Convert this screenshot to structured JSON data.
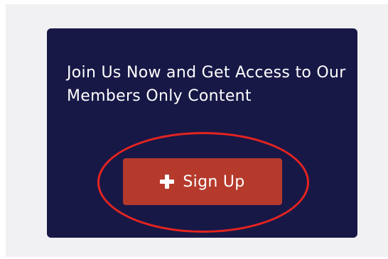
{
  "card": {
    "message": "Join Us Now and Get Access to Our Members Only Content",
    "background_color": "#181847"
  },
  "signup_button": {
    "icon": "plus-icon",
    "label": "Sign Up",
    "color": "#b53a2c"
  },
  "annotation": {
    "type": "highlight-ring",
    "color": "#e5241f"
  }
}
